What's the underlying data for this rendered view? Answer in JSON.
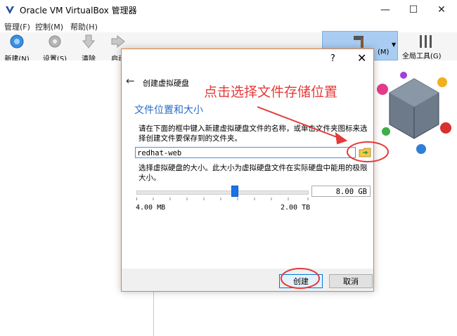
{
  "window": {
    "title": "Oracle VM VirtualBox 管理器",
    "minimize": "—",
    "maximize": "☐",
    "close": "✕"
  },
  "menu": {
    "items": [
      {
        "label": "管理(F)"
      },
      {
        "label": "控制(M)"
      },
      {
        "label": "帮助(H)"
      }
    ]
  },
  "toolbar": {
    "new_label": "新建(N)",
    "settings_label": "设置(S)",
    "discard_label": "清除",
    "start_label": "启动",
    "machine_tools_label": "(M)",
    "global_tools_label": "全局工具(G)"
  },
  "dialog": {
    "help": "?",
    "close": "✕",
    "back": "←",
    "title": "创建虚拟硬盘",
    "section_title": "文件位置和大小",
    "description1": "请在下面的框中键入新建虚拟硬盘文件的名称，或单击文件夹图标来选择创建文件要保存到的文件夹。",
    "file_name": "redhat-web",
    "description2": "选择虚拟硬盘的大小。此大小为虚拟硬盘文件在实际硬盘中能用的极限大小。",
    "size_value": "8.00 GB",
    "size_min": "4.00 MB",
    "size_max": "2.00 TB",
    "slider_level_percent": 57,
    "create_button": "创建",
    "cancel_button": "取消"
  },
  "annotation": {
    "text": "点击选择文件存储位置",
    "color": "#e53a3a"
  },
  "colors": {
    "accent": "#2a6cc7",
    "selected_tool": "#a9cdf2",
    "dialog_border": "#e0813a"
  }
}
